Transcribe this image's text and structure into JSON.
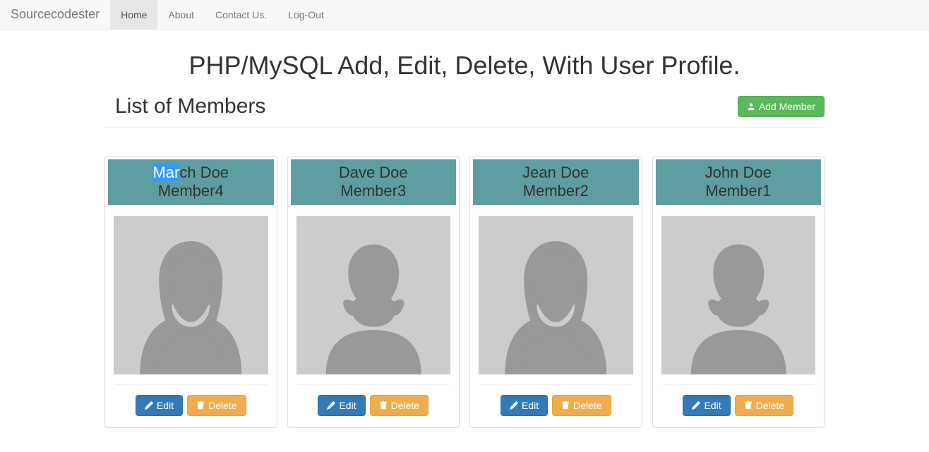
{
  "nav": {
    "brand": "Sourcecodester",
    "items": [
      {
        "label": "Home",
        "active": true
      },
      {
        "label": "About",
        "active": false
      },
      {
        "label": "Contact Us.",
        "active": false
      },
      {
        "label": "Log-Out",
        "active": false
      }
    ]
  },
  "page": {
    "title": "PHP/MySQL Add, Edit, Delete, With User Profile.",
    "list_heading": "List of Members",
    "add_member_label": "Add Member"
  },
  "actions": {
    "edit_label": "Edit",
    "delete_label": "Delete"
  },
  "members": [
    {
      "name_prefix_selected": "Mar",
      "name_rest": "ch Doe",
      "role": "Member4",
      "avatar_variant": "female"
    },
    {
      "name": "Dave Doe",
      "role": "Member3",
      "avatar_variant": "male"
    },
    {
      "name": "Jean Doe",
      "role": "Member2",
      "avatar_variant": "female"
    },
    {
      "name": "John Doe",
      "role": "Member1",
      "avatar_variant": "male"
    }
  ]
}
